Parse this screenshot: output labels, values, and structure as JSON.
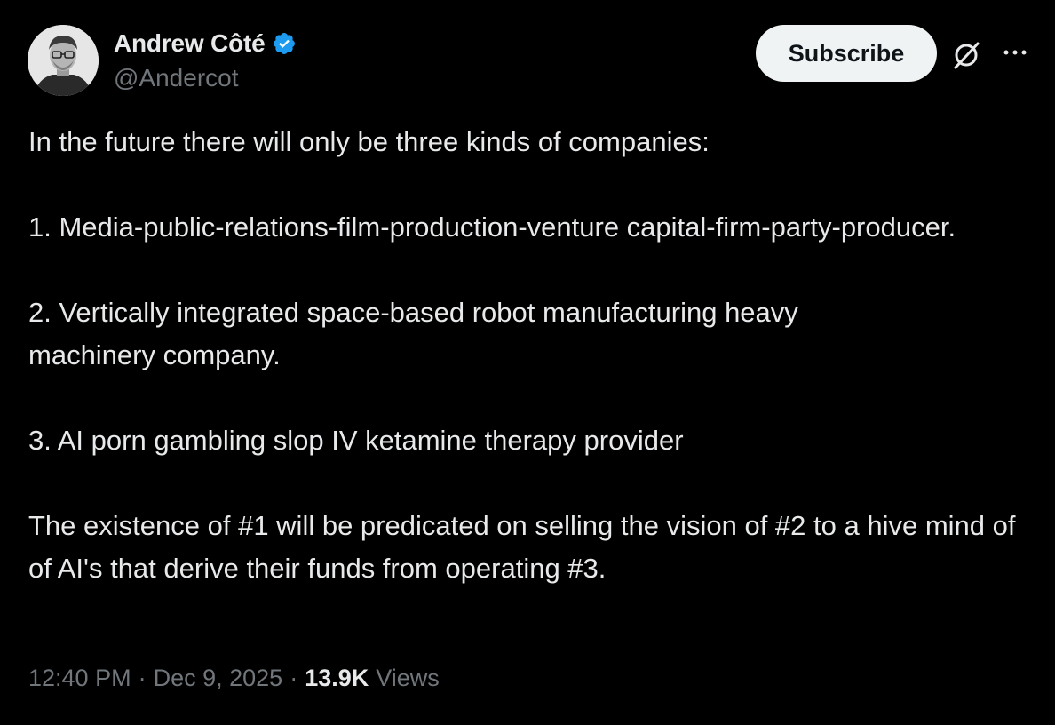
{
  "author": {
    "display_name": "Andrew Côté",
    "handle": "@Andercot",
    "verified": true,
    "verified_color": "#1d9bf0"
  },
  "actions": {
    "subscribe_label": "Subscribe",
    "grok_icon": "grok-icon",
    "more_icon": "more-icon"
  },
  "tweet": {
    "intro": "In the future there will only be three kinds of companies:",
    "item1": "1. Media-public-relations-film-production-venture capital-firm-party-producer.",
    "item2": "2. Vertically integrated space-based robot manufacturing heavy machinery company.",
    "item3": "3. AI porn gambling slop IV ketamine therapy provider",
    "conclusion": "The existence of #1 will be predicated on selling the vision of #2 to a hive mind of of AI's that derive their funds from operating #3."
  },
  "meta": {
    "time": "12:40 PM",
    "separator": "·",
    "date": "Dec 9, 2025",
    "views_count": "13.9K",
    "views_label": "Views"
  },
  "colors": {
    "background": "#000000",
    "primary_text": "#e7e9ea",
    "secondary_text": "#71767b",
    "button_bg": "#eff3f4"
  }
}
